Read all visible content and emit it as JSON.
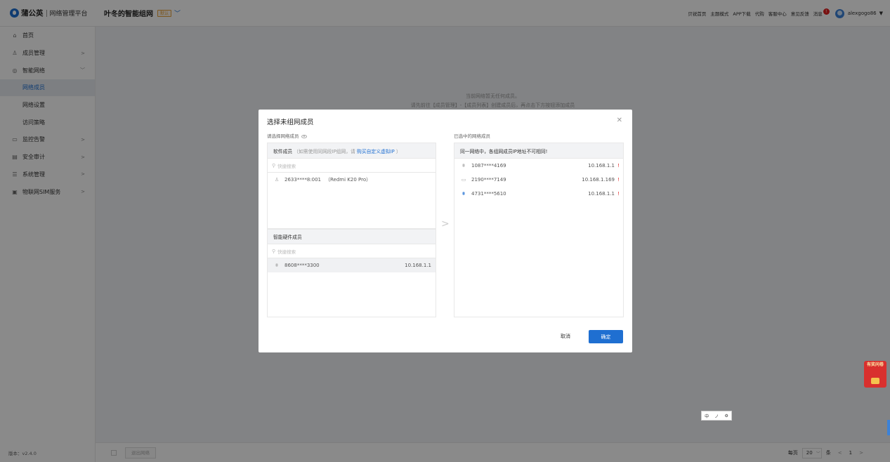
{
  "header": {
    "brand_name": "蒲公英",
    "brand_sub": "网络管理平台",
    "network_name": "叶冬的智能组网",
    "network_badge": "默认",
    "links": [
      "贝锐首页",
      "主题模式",
      "APP下载",
      "代购",
      "客服中心",
      "意见反馈"
    ],
    "messages_label": "消息",
    "messages_count": "!",
    "username": "alexgogo86"
  },
  "sidebar": {
    "items": [
      {
        "label": "首页",
        "icon": "home-icon"
      },
      {
        "label": "成员管理",
        "icon": "user-icon"
      },
      {
        "label": "智能网络",
        "icon": "network-icon"
      },
      {
        "label": "网络成员"
      },
      {
        "label": "网络设置"
      },
      {
        "label": "访问策略"
      },
      {
        "label": "监控告警",
        "icon": "monitor-icon"
      },
      {
        "label": "安全审计",
        "icon": "audit-icon"
      },
      {
        "label": "系统管理",
        "icon": "system-icon"
      },
      {
        "label": "物联网SIM服务",
        "icon": "sim-icon"
      }
    ],
    "version": "版本：v2.4.0"
  },
  "main": {
    "empty_line1": "当前网络暂无任何成员。",
    "empty_line2": "请先前往【成员管理】-【成员列表】创建成员后，再点击下方按钮添加成员"
  },
  "footer": {
    "exit_label": "退出网络",
    "per_page_label": "每页",
    "per_page_value": "20",
    "per_page_unit": "条",
    "page": "1"
  },
  "modal": {
    "title": "选择未组网成员",
    "left_label": "请选择网络成员",
    "right_label": "已选中的网络成员",
    "software_head": "软件成员",
    "software_hint": "（如需使用同网段IP组网，请",
    "software_link": "购买自定义虚拟IP",
    "software_hint_end": "）",
    "search_placeholder": "快捷搜索",
    "software_rows": [
      {
        "id": "2633****8:001",
        "device": "（Redmi K20 Pro）"
      }
    ],
    "hardware_head": "智能硬件成员",
    "hardware_rows": [
      {
        "id": "8608****3300",
        "ip": "10.168.1.1"
      }
    ],
    "right_head": "同一网络中，各组网成员IP地址不可相同!",
    "right_rows": [
      {
        "id": "1087****4169",
        "ip": "10.168.1.1",
        "warn": "!"
      },
      {
        "id": "2190****7149",
        "ip": "10.168.1.169",
        "warn": "!"
      },
      {
        "id": "4731****5610",
        "ip": "10.168.1.1",
        "warn": "!"
      }
    ],
    "cancel_label": "取消",
    "ok_label": "确定"
  },
  "widgets": {
    "red_packet_text": "有奖问卷",
    "ime_chars": [
      "中",
      "ノ",
      "⚙"
    ]
  }
}
